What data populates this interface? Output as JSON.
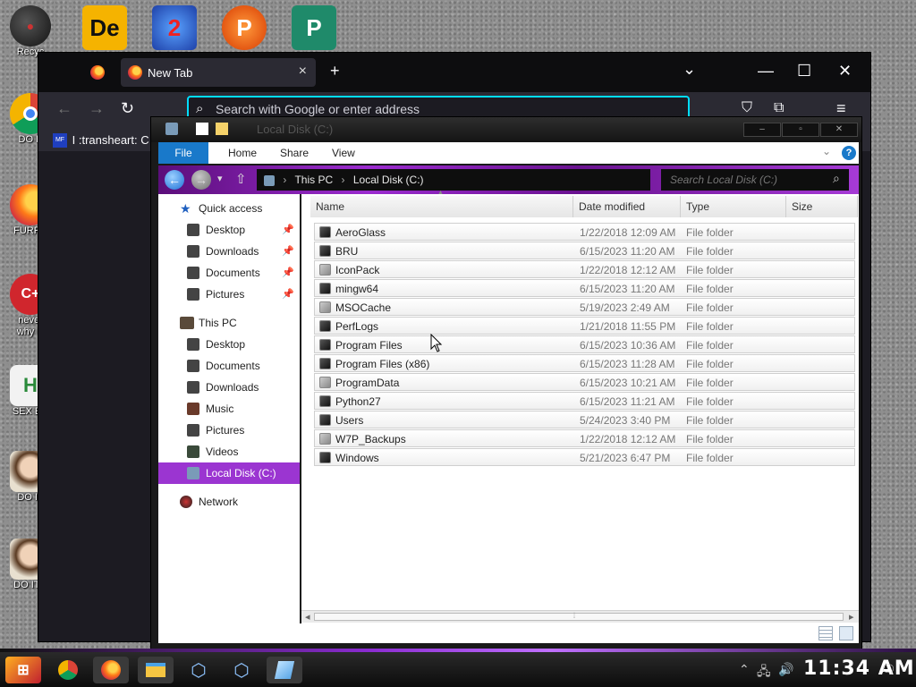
{
  "desktop": {
    "left_icons": [
      {
        "label": "Recyc",
        "name": "recycle-bin"
      },
      {
        "label": "DO E",
        "name": "chrome-shortcut"
      },
      {
        "label": "FURRY",
        "name": "firefox-shortcut"
      },
      {
        "label": "never",
        "label2": "why is",
        "name": "dev-cpp-shortcut"
      },
      {
        "label": "SEX ED",
        "name": "hxd-shortcut"
      },
      {
        "label": "DO IT",
        "name": "portrait-shortcut-1"
      },
      {
        "label": "DO IT c",
        "name": "portrait-shortcut-2"
      }
    ],
    "top_icons": [
      {
        "glyph": "De",
        "name": "de-app-icon"
      },
      {
        "glyph": "2",
        "name": "2-app-icon"
      },
      {
        "glyph": "P",
        "name": "p-app-icon"
      },
      {
        "glyph": "P",
        "name": "publisher-icon"
      }
    ]
  },
  "browser": {
    "tab_title": "New Tab",
    "tab_close": "×",
    "new_tab": "+",
    "tab_list": "⌄",
    "window_controls": {
      "minimize": "—",
      "maximize": "☐",
      "close": "✕"
    },
    "nav": {
      "back": "←",
      "forward": "→",
      "reload": "↻"
    },
    "url_placeholder": "Search with Google or enter address",
    "toolbar": {
      "pocket": "⛉",
      "extensions": "⧉",
      "menu": "≡"
    },
    "bookmark_badge": "MF",
    "bookmark_label": "I :transheart: C"
  },
  "explorer": {
    "title": "Local Disk (C:)",
    "window_controls": {
      "minimize": "‒",
      "maximize": "▫",
      "close": "✕"
    },
    "ribbon_tabs": [
      "File",
      "Home",
      "Share",
      "View"
    ],
    "ribbon_expand": "⌄",
    "help": "?",
    "back": "←",
    "forward": "→",
    "recent": "▾",
    "up": "⇧",
    "breadcrumb": [
      "This PC",
      "Local Disk (C:)"
    ],
    "breadcrumb_sep": "›",
    "search_placeholder": "Search Local Disk (C:)",
    "search_glyph": "⌕",
    "sort_glyph": "▲",
    "nav": {
      "quick_access": "Quick access",
      "quick_items": [
        "Desktop",
        "Downloads",
        "Documents",
        "Pictures"
      ],
      "pin": "📌",
      "this_pc": "This PC",
      "pc_items": [
        "Desktop",
        "Documents",
        "Downloads",
        "Music",
        "Pictures",
        "Videos"
      ],
      "selected": "Local Disk (C:)",
      "network": "Network"
    },
    "columns": [
      "Name",
      "Date modified",
      "Type",
      "Size"
    ],
    "files": [
      {
        "name": "AeroGlass",
        "date": "1/22/2018 12:09 AM",
        "type": "File folder"
      },
      {
        "name": "BRU",
        "date": "6/15/2023 11:20 AM",
        "type": "File folder"
      },
      {
        "name": "IconPack",
        "date": "1/22/2018 12:12 AM",
        "type": "File folder"
      },
      {
        "name": "mingw64",
        "date": "6/15/2023 11:20 AM",
        "type": "File folder"
      },
      {
        "name": "MSOCache",
        "date": "5/19/2023 2:49 AM",
        "type": "File folder"
      },
      {
        "name": "PerfLogs",
        "date": "1/21/2018 11:55 PM",
        "type": "File folder"
      },
      {
        "name": "Program Files",
        "date": "6/15/2023 10:36 AM",
        "type": "File folder"
      },
      {
        "name": "Program Files (x86)",
        "date": "6/15/2023 11:28 AM",
        "type": "File folder"
      },
      {
        "name": "ProgramData",
        "date": "6/15/2023 10:21 AM",
        "type": "File folder"
      },
      {
        "name": "Python27",
        "date": "6/15/2023 11:21 AM",
        "type": "File folder"
      },
      {
        "name": "Users",
        "date": "5/24/2023 3:40 PM",
        "type": "File folder"
      },
      {
        "name": "W7P_Backups",
        "date": "1/22/2018 12:12 AM",
        "type": "File folder"
      },
      {
        "name": "Windows",
        "date": "5/21/2023 6:47 PM",
        "type": "File folder"
      }
    ],
    "scroll": {
      "left": "◂",
      "right": "▸",
      "thumb": "⦙"
    }
  },
  "taskbar": {
    "clock": "11:34 AM",
    "apps": [
      "start",
      "chrome",
      "firefox",
      "file-explorer",
      "virtualbox-1",
      "virtualbox-2",
      "notepad"
    ],
    "tray_chevron": "⌃",
    "tray_network": "🖧",
    "tray_volume": "🔊",
    "tray_notification": "🗨"
  },
  "colors": {
    "accent": "#9b35d1",
    "file_tab": "#1979ca",
    "browser_focus": "#00ddff"
  }
}
